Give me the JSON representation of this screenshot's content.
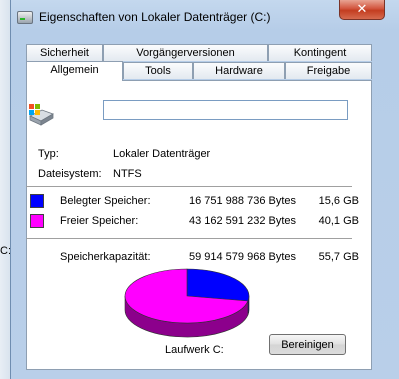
{
  "backdrop": {
    "partial_text": "C:)"
  },
  "window": {
    "title": "Eigenschaften von Lokaler Datenträger (C:)",
    "close_glyph": "✕"
  },
  "tabs": {
    "row1": [
      "Sicherheit",
      "Vorgängerversionen",
      "Kontingent"
    ],
    "row2": [
      "Allgemein",
      "Tools",
      "Hardware",
      "Freigabe"
    ],
    "active": "Allgemein"
  },
  "general": {
    "name_value": "",
    "type_label": "Typ:",
    "type_value": "Lokaler Datenträger",
    "fs_label": "Dateisystem:",
    "fs_value": "NTFS",
    "used": {
      "label": "Belegter Speicher:",
      "bytes": "16 751 988 736 Bytes",
      "size": "15,6 GB",
      "color": "#0000ff"
    },
    "free": {
      "label": "Freier Speicher:",
      "bytes": "43 162 591 232 Bytes",
      "size": "40,1 GB",
      "color": "#ff00ff"
    },
    "capacity": {
      "label": "Speicherkapazität:",
      "bytes": "59 914 579 968 Bytes",
      "size": "55,7 GB"
    },
    "drive_label": "Laufwerk C:",
    "cleanup_button": "Bereinigen"
  },
  "chart_data": {
    "type": "pie",
    "categories": [
      "Belegter Speicher",
      "Freier Speicher"
    ],
    "values": [
      16751988736,
      43162591232
    ],
    "colors": [
      "#0000ff",
      "#ff00ff"
    ]
  }
}
